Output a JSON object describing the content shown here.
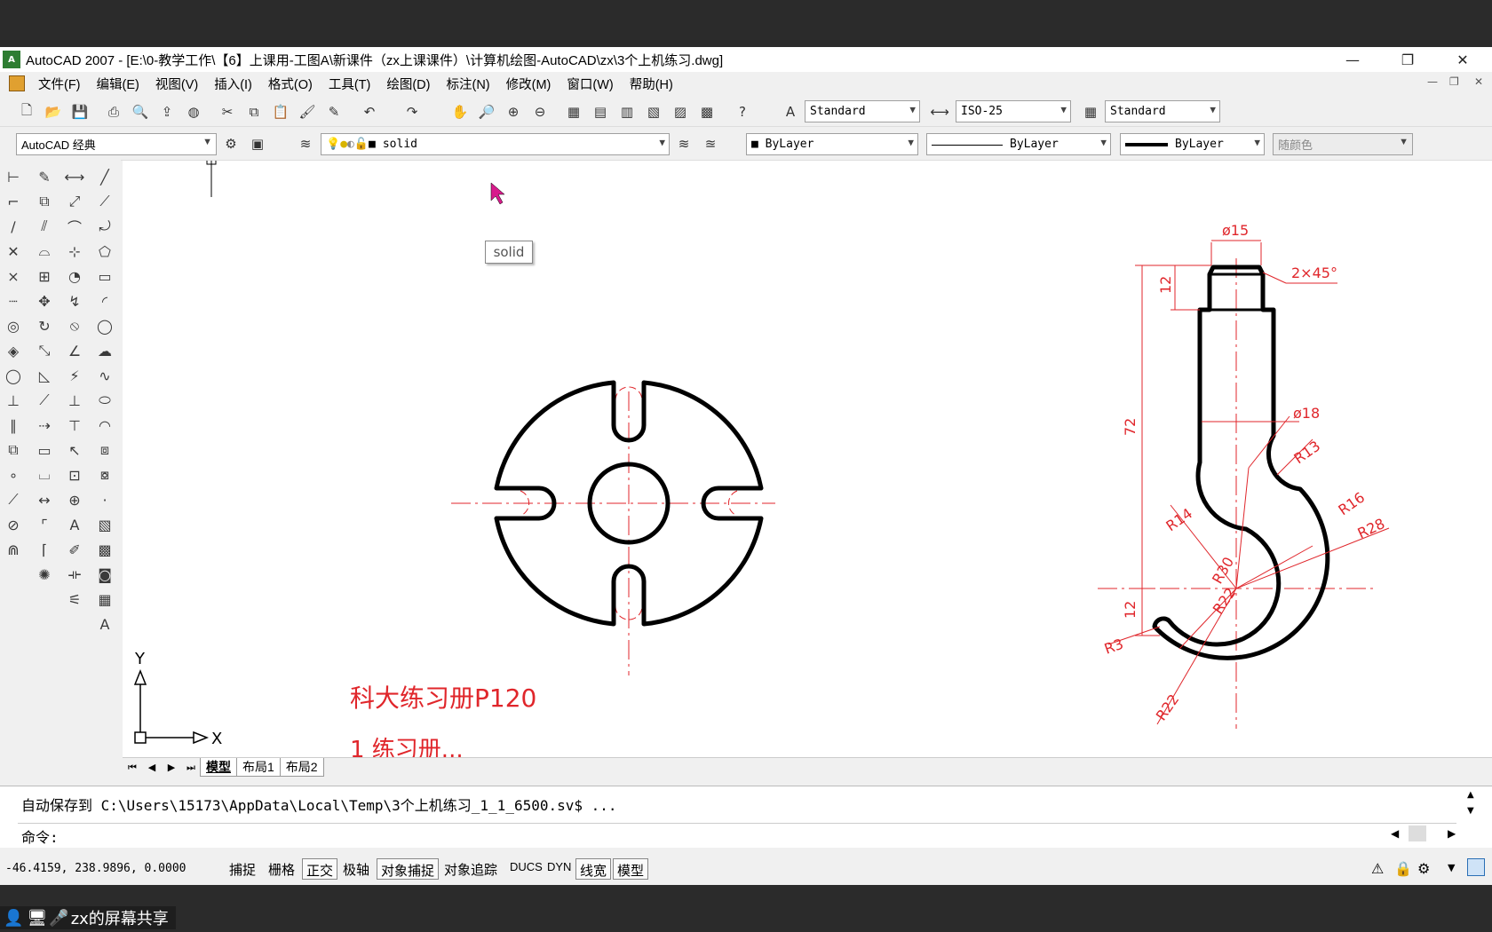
{
  "window": {
    "title": "AutoCAD 2007 - [E:\\0-教学工作\\【6】上课用-工图A\\新课件（zx上课课件）\\计算机绘图-AutoCAD\\zx\\3个上机练习.dwg]",
    "app_icon": "A"
  },
  "menu": [
    "文件(F)",
    "编辑(E)",
    "视图(V)",
    "插入(I)",
    "格式(O)",
    "工具(T)",
    "绘图(D)",
    "标注(N)",
    "修改(M)",
    "窗口(W)",
    "帮助(H)"
  ],
  "styles": {
    "text_style": "Standard",
    "dim_style": "ISO-25",
    "table_style": "Standard"
  },
  "properties": {
    "workspace": "AutoCAD 经典",
    "layer": "solid",
    "color": "ByLayer",
    "linetype": "ByLayer",
    "lineweight": "ByLayer",
    "plot_style": "随颜色"
  },
  "tooltip": "solid",
  "drawing": {
    "caption": "科大练习册P120",
    "caption2": "1  练习册...",
    "dims": {
      "d15": "ø15",
      "chamfer": "2×45°",
      "h12_top": "12",
      "d18": "ø18",
      "r13": "R13",
      "h72": "72",
      "r16": "R16",
      "r28": "R28",
      "r14": "R14",
      "r30": "R30",
      "r22a": "R22",
      "h12_bot": "12",
      "r3": "R3",
      "r22b": "R22"
    },
    "ucs_x": "X",
    "ucs_y": "Y",
    "colors": {
      "dim": "#e0262b",
      "outline": "#000000"
    }
  },
  "tabs": {
    "model": "模型",
    "layout1": "布局1",
    "layout2": "布局2"
  },
  "command": {
    "history": "自动保存到 C:\\Users\\15173\\AppData\\Local\\Temp\\3个上机练习_1_1_6500.sv$ ...",
    "prompt": "命令:"
  },
  "status": {
    "coords": "-46.4159, 238.9896, 0.0000",
    "buttons": [
      "捕捉",
      "栅格",
      "正交",
      "极轴",
      "对象捕捉",
      "对象追踪",
      "DUCS",
      "DYN",
      "线宽",
      "模型"
    ]
  },
  "share": {
    "label": "zx的屏幕共享"
  }
}
